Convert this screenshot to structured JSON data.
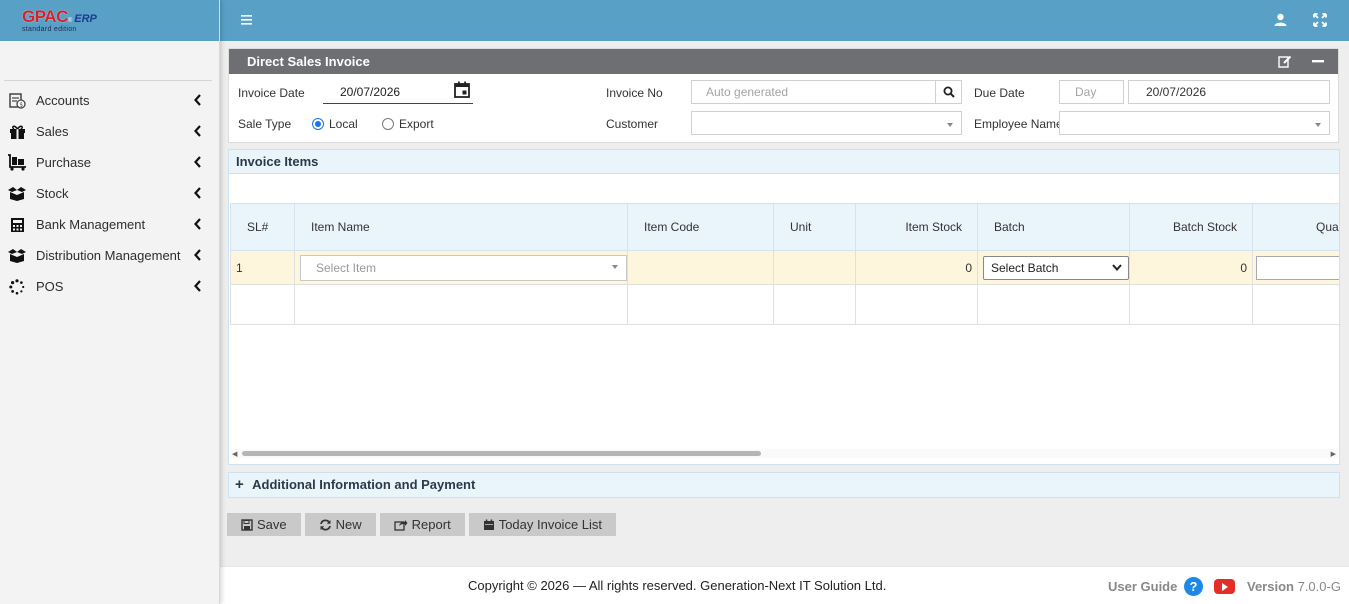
{
  "brand": {
    "logo_main": "GPAC",
    "logo_reg": "®",
    "logo_erp": "ERP",
    "logo_sub": "standard edition"
  },
  "sidebar": {
    "items": [
      {
        "label": "Accounts",
        "icon": "accounts-icon"
      },
      {
        "label": "Sales",
        "icon": "gift-icon"
      },
      {
        "label": "Purchase",
        "icon": "purchase-icon"
      },
      {
        "label": "Stock",
        "icon": "box-icon"
      },
      {
        "label": "Bank Management",
        "icon": "calculator-icon"
      },
      {
        "label": "Distribution Management",
        "icon": "box-icon"
      },
      {
        "label": "POS",
        "icon": "spinner-icon"
      }
    ]
  },
  "form": {
    "title": "Direct Sales Invoice",
    "invoice_date_label": "Invoice Date",
    "invoice_date_value": "20/07/2026",
    "invoice_no_label": "Invoice No",
    "invoice_no_placeholder": "Auto generated",
    "due_date_label": "Due Date",
    "due_day_placeholder": "Day",
    "due_date_value": "20/07/2026",
    "sale_type_label": "Sale Type",
    "sale_type_options": [
      "Local",
      "Export"
    ],
    "sale_type_selected": "Local",
    "customer_label": "Customer",
    "employee_label": "Employee Name"
  },
  "items": {
    "title": "Invoice Items",
    "columns": [
      "SL#",
      "Item Name",
      "Item Code",
      "Unit",
      "Item Stock",
      "Batch",
      "Batch Stock",
      "Quar"
    ],
    "rows": [
      {
        "sl": "1",
        "item_placeholder": "Select Item",
        "code": "",
        "unit": "",
        "item_stock": "0",
        "batch_placeholder": "Select Batch",
        "batch_stock": "0"
      }
    ]
  },
  "additional": {
    "title": "Additional Information and Payment",
    "plus": "+"
  },
  "buttons": {
    "save": "Save",
    "new": "New",
    "report": "Report",
    "today_list": "Today Invoice List"
  },
  "footer": {
    "copyright": "Copyright © 2026 — All rights reserved. Generation-Next IT Solution Ltd.",
    "user_guide": "User Guide",
    "help": "?",
    "version_label": "Version",
    "version_value": "7.0.0-G"
  },
  "colors": {
    "topbar": "#58a0c5",
    "panel_header": "#6d6f72",
    "row_highlight": "#fdf6dd",
    "section_bg": "#eaf4fb"
  }
}
